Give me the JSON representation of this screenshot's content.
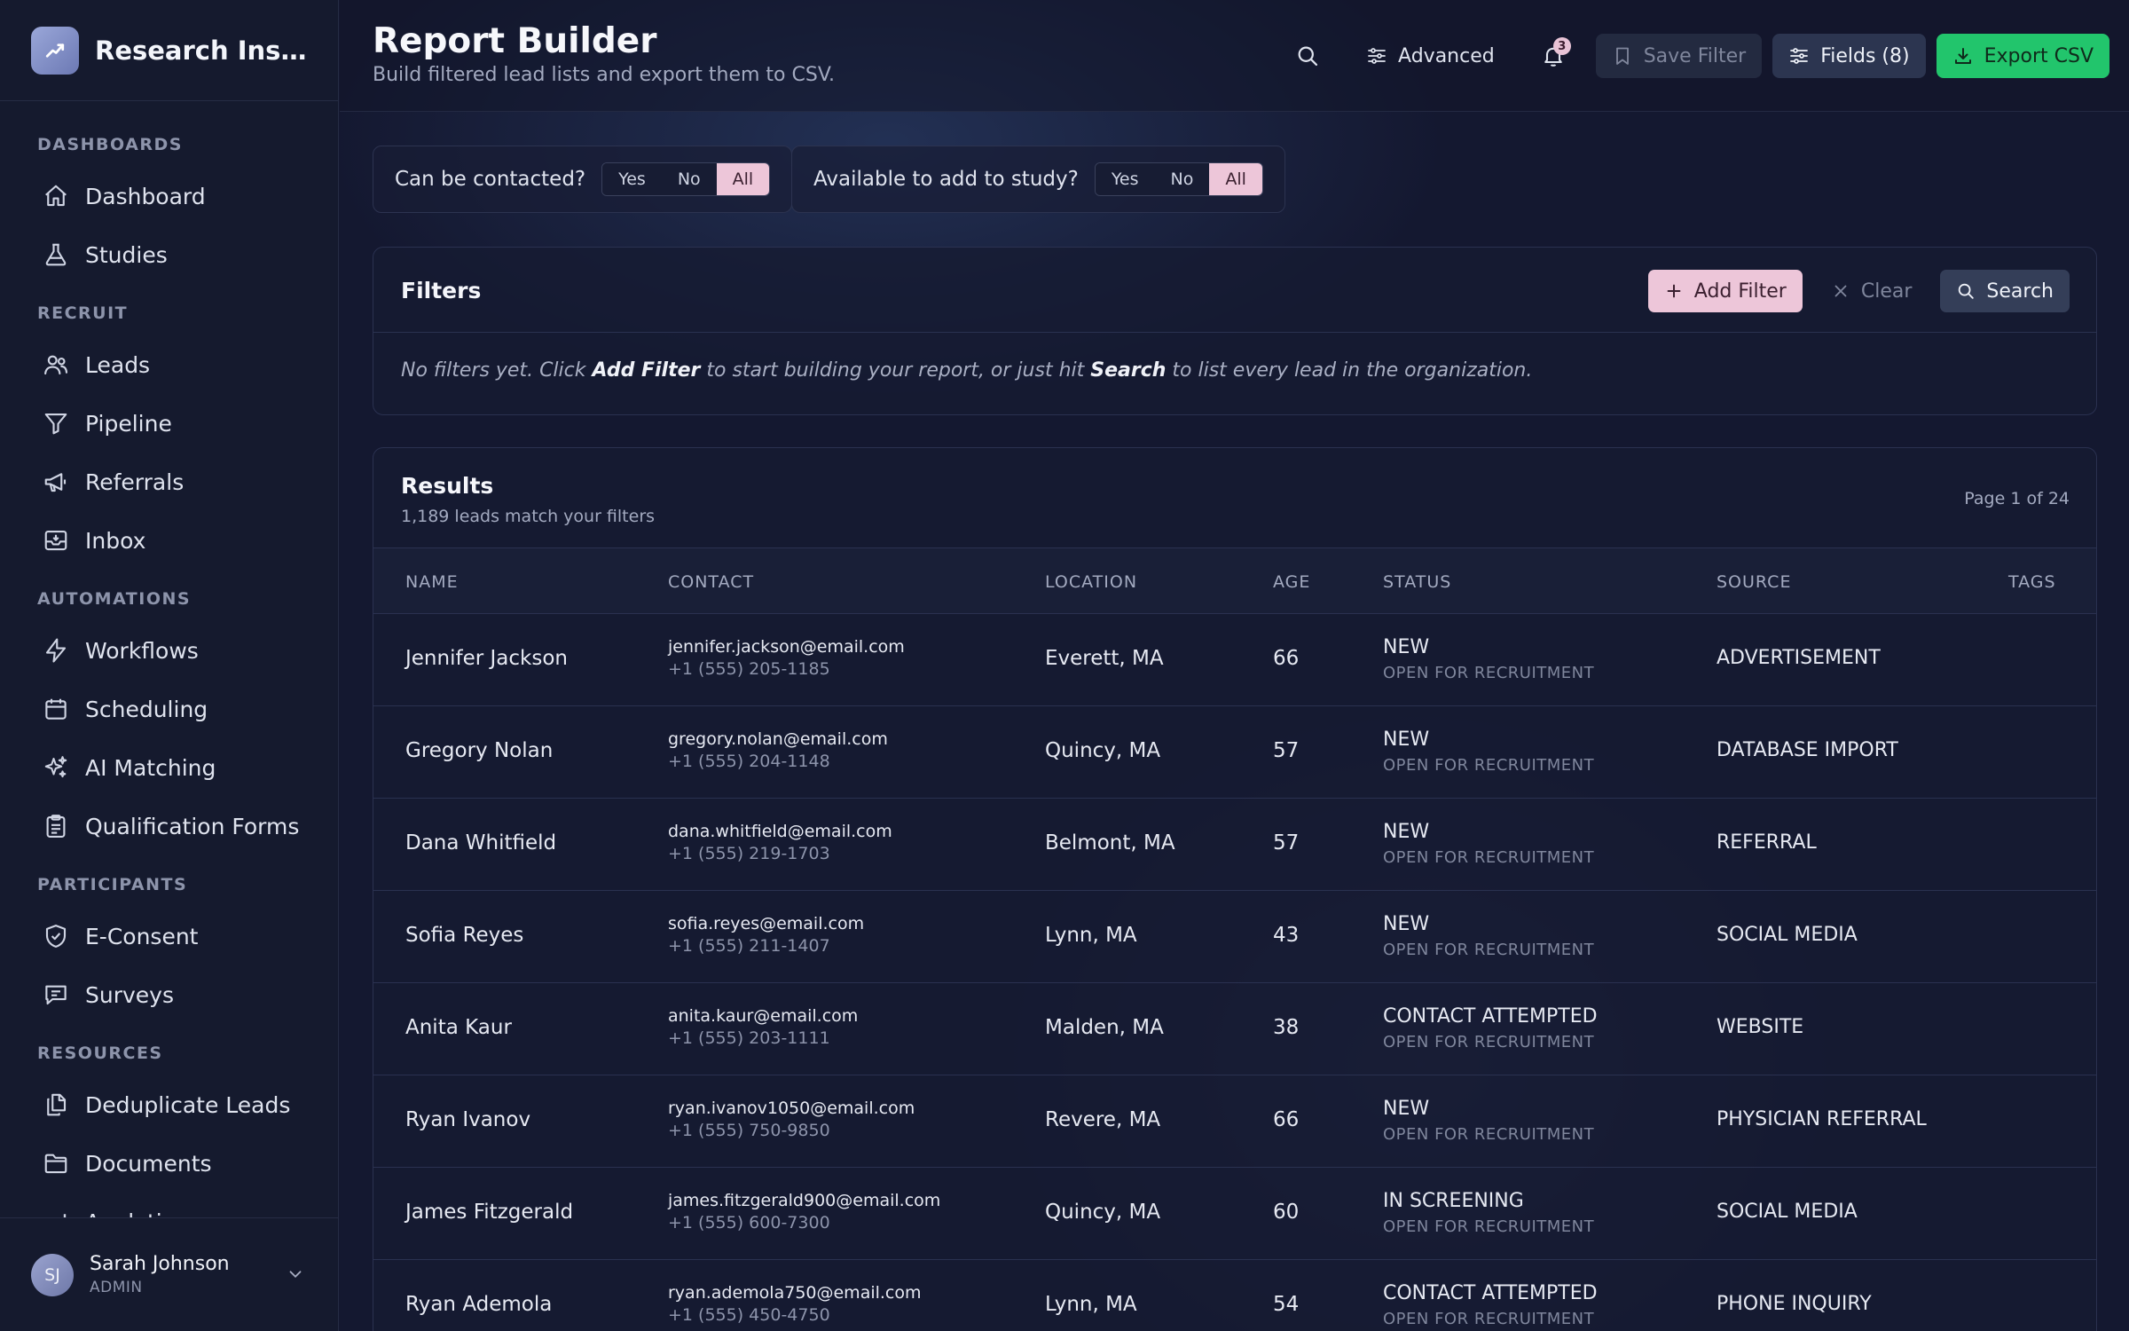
{
  "brand": {
    "name": "Research Inst..."
  },
  "sidebar": {
    "sections": [
      {
        "title": "DASHBOARDS",
        "items": [
          {
            "label": "Dashboard",
            "icon": "home-icon"
          },
          {
            "label": "Studies",
            "icon": "flask-icon"
          }
        ]
      },
      {
        "title": "RECRUIT",
        "items": [
          {
            "label": "Leads",
            "icon": "users-icon"
          },
          {
            "label": "Pipeline",
            "icon": "funnel-icon"
          },
          {
            "label": "Referrals",
            "icon": "megaphone-icon"
          },
          {
            "label": "Inbox",
            "icon": "inbox-icon"
          }
        ]
      },
      {
        "title": "AUTOMATIONS",
        "items": [
          {
            "label": "Workflows",
            "icon": "bolt-icon"
          },
          {
            "label": "Scheduling",
            "icon": "calendar-icon"
          },
          {
            "label": "AI Matching",
            "icon": "sparkles-icon"
          },
          {
            "label": "Qualification Forms",
            "icon": "clipboard-icon"
          }
        ]
      },
      {
        "title": "PARTICIPANTS",
        "items": [
          {
            "label": "E-Consent",
            "icon": "shield-check-icon"
          },
          {
            "label": "Surveys",
            "icon": "message-icon"
          }
        ]
      },
      {
        "title": "RESOURCES",
        "items": [
          {
            "label": "Deduplicate Leads",
            "icon": "copy-icon"
          },
          {
            "label": "Documents",
            "icon": "folder-icon"
          },
          {
            "label": "Analytics",
            "icon": "chart-icon"
          }
        ]
      }
    ]
  },
  "user": {
    "initials": "SJ",
    "name": "Sarah Johnson",
    "role": "ADMIN"
  },
  "header": {
    "title": "Report Builder",
    "subtitle": "Build filtered lead lists and export them to CSV.",
    "advanced_label": "Advanced",
    "notification_count": "3",
    "save_filter_label": "Save Filter",
    "fields_label": "Fields (8)",
    "export_label": "Export CSV"
  },
  "toggles": [
    {
      "label": "Can be contacted?",
      "options": [
        "Yes",
        "No",
        "All"
      ],
      "selected": "All"
    },
    {
      "label": "Available to add to study?",
      "options": [
        "Yes",
        "No",
        "All"
      ],
      "selected": "All"
    }
  ],
  "filters": {
    "title": "Filters",
    "add_label": "Add Filter",
    "clear_label": "Clear",
    "search_label": "Search",
    "empty_parts": [
      "No filters yet. Click ",
      "Add Filter",
      " to start building your report, or just hit ",
      "Search",
      " to list every lead in the organization."
    ]
  },
  "results": {
    "title": "Results",
    "count": "1,189 leads match your filters",
    "page": "Page 1 of 24",
    "columns": [
      "NAME",
      "CONTACT",
      "LOCATION",
      "AGE",
      "STATUS",
      "SOURCE",
      "TAGS"
    ],
    "rows": [
      {
        "name": "Jennifer Jackson",
        "email": "jennifer.jackson@email.com",
        "phone": "+1 (555) 205-1185",
        "location": "Everett, MA",
        "age": "66",
        "status": "NEW",
        "substatus": "OPEN FOR RECRUITMENT",
        "source": "ADVERTISEMENT"
      },
      {
        "name": "Gregory Nolan",
        "email": "gregory.nolan@email.com",
        "phone": "+1 (555) 204-1148",
        "location": "Quincy, MA",
        "age": "57",
        "status": "NEW",
        "substatus": "OPEN FOR RECRUITMENT",
        "source": "DATABASE IMPORT"
      },
      {
        "name": "Dana Whitfield",
        "email": "dana.whitfield@email.com",
        "phone": "+1 (555) 219-1703",
        "location": "Belmont, MA",
        "age": "57",
        "status": "NEW",
        "substatus": "OPEN FOR RECRUITMENT",
        "source": "REFERRAL"
      },
      {
        "name": "Sofia Reyes",
        "email": "sofia.reyes@email.com",
        "phone": "+1 (555) 211-1407",
        "location": "Lynn, MA",
        "age": "43",
        "status": "NEW",
        "substatus": "OPEN FOR RECRUITMENT",
        "source": "SOCIAL MEDIA"
      },
      {
        "name": "Anita Kaur",
        "email": "anita.kaur@email.com",
        "phone": "+1 (555) 203-1111",
        "location": "Malden, MA",
        "age": "38",
        "status": "CONTACT ATTEMPTED",
        "substatus": "OPEN FOR RECRUITMENT",
        "source": "WEBSITE"
      },
      {
        "name": "Ryan Ivanov",
        "email": "ryan.ivanov1050@email.com",
        "phone": "+1 (555) 750-9850",
        "location": "Revere, MA",
        "age": "66",
        "status": "NEW",
        "substatus": "OPEN FOR RECRUITMENT",
        "source": "PHYSICIAN REFERRAL"
      },
      {
        "name": "James Fitzgerald",
        "email": "james.fitzgerald900@email.com",
        "phone": "+1 (555) 600-7300",
        "location": "Quincy, MA",
        "age": "60",
        "status": "IN SCREENING",
        "substatus": "OPEN FOR RECRUITMENT",
        "source": "SOCIAL MEDIA"
      },
      {
        "name": "Ryan Ademola",
        "email": "ryan.ademola750@email.com",
        "phone": "+1 (555) 450-4750",
        "location": "Lynn, MA",
        "age": "54",
        "status": "CONTACT ATTEMPTED",
        "substatus": "OPEN FOR RECRUITMENT",
        "source": "PHONE INQUIRY"
      }
    ]
  },
  "colors": {
    "accent_pink": "#edc6d9",
    "export_green": "#22c56c",
    "background": "#141830"
  }
}
